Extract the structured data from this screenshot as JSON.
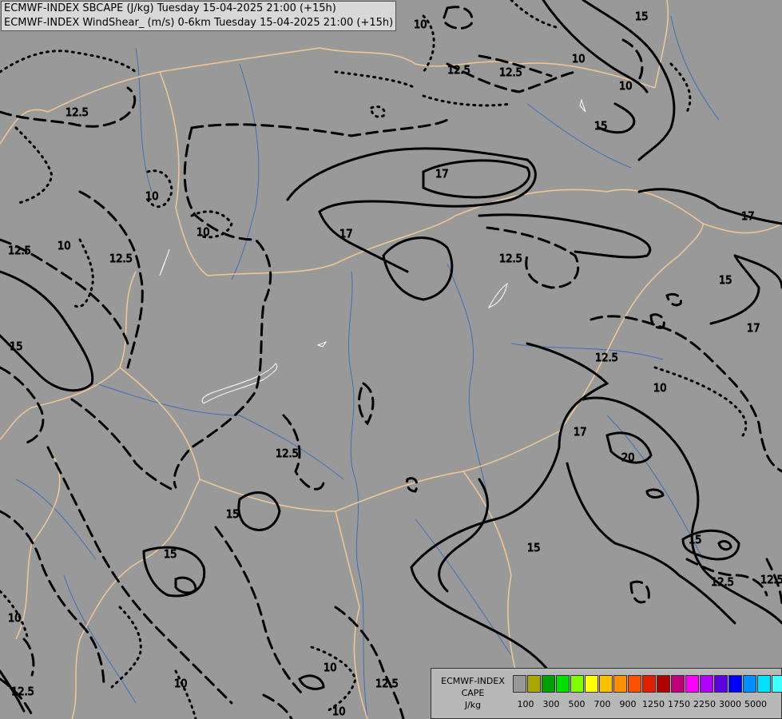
{
  "header": {
    "line1": "ECMWF-INDEX SBCAPE (J/kg) Tuesday 15-04-2025 21:00 (+15h)",
    "line2": "ECMWF-INDEX WindShear_ (m/s) 0-6km Tuesday 15-04-2025 21:00 (+15h)"
  },
  "contour_labels": [
    "10",
    "12.5",
    "15",
    "17",
    "20"
  ],
  "legend": {
    "title_line1": "ECMWF-INDEX",
    "title_line2": "CAPE",
    "title_line3": "J/kg",
    "colors": [
      "#999999",
      "#a8a800",
      "#00a000",
      "#00e000",
      "#80ff00",
      "#ffff00",
      "#ffc000",
      "#ff9000",
      "#ff5000",
      "#e02000",
      "#b00000",
      "#c0007a",
      "#ff00ff",
      "#b000ff",
      "#6000e0",
      "#0000ff",
      "#0090ff",
      "#00e0ff",
      "#40ffff",
      "#ffffff"
    ],
    "ticks": [
      "100",
      "300",
      "500",
      "700",
      "900",
      "1250",
      "1750",
      "2250",
      "3000",
      "5000"
    ]
  },
  "colors": {
    "background": "#999999",
    "borders": "#f0c896",
    "rivers": "#3f6fb5",
    "contours": "#000000"
  }
}
